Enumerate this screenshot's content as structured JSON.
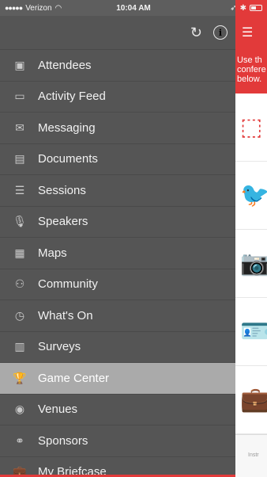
{
  "status_bar": {
    "signal": "●●●●●",
    "carrier": "Verizon",
    "wifi_icon": "wifi-icon",
    "time": "10:04 AM",
    "location_icon": "location-icon",
    "bluetooth_icon": "bluetooth-icon"
  },
  "menu": {
    "refresh_icon": "↻",
    "info_icon": "i",
    "items": [
      {
        "label": "Attendees",
        "icon": "▣"
      },
      {
        "label": "Activity Feed",
        "icon": "▭"
      },
      {
        "label": "Messaging",
        "icon": "✉"
      },
      {
        "label": "Documents",
        "icon": "▤"
      },
      {
        "label": "Sessions",
        "icon": "☰"
      },
      {
        "label": "Speakers",
        "icon": "🎙"
      },
      {
        "label": "Maps",
        "icon": "▦"
      },
      {
        "label": "Community",
        "icon": "⚇"
      },
      {
        "label": "What's On",
        "icon": "◷"
      },
      {
        "label": "Surveys",
        "icon": "▥"
      },
      {
        "label": "Game Center",
        "icon": "🏆",
        "active": true
      },
      {
        "label": "Venues",
        "icon": "◉"
      },
      {
        "label": "Sponsors",
        "icon": "⚭"
      },
      {
        "label": "My Briefcase",
        "icon": "💼"
      }
    ]
  },
  "content": {
    "hamburger": "☰",
    "intro_lines": [
      "Use th",
      "confere",
      "below."
    ],
    "tiles": [
      "⬚",
      "🐦",
      "📷",
      "🪪",
      "💼"
    ],
    "footer_label": "Instr"
  },
  "colors": {
    "accent": "#e23a3a",
    "menu_bg": "#555555",
    "active_item": "#aaaaaa"
  }
}
